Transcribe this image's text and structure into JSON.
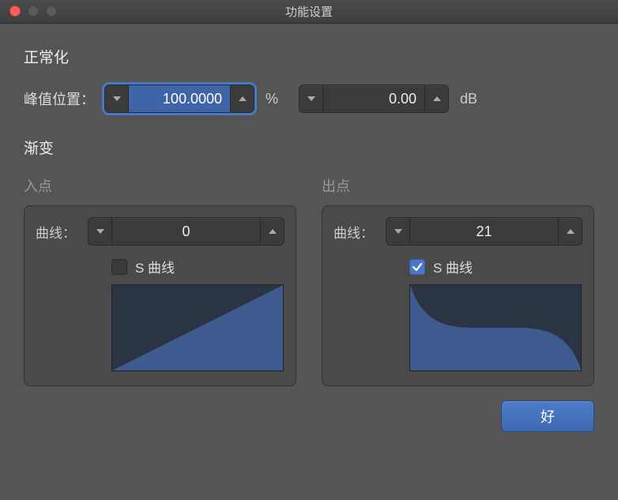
{
  "window": {
    "title": "功能设置"
  },
  "normalize": {
    "heading": "正常化",
    "peak_label": "峰值位置：",
    "percent_value": "100.0000",
    "percent_unit": "%",
    "db_value": "0.00",
    "db_unit": "dB"
  },
  "fade": {
    "heading": "渐变",
    "in": {
      "heading": "入点",
      "curve_label": "曲线：",
      "curve_value": "0",
      "s_curve_label": "S 曲线",
      "s_curve_checked": false
    },
    "out": {
      "heading": "出点",
      "curve_label": "曲线：",
      "curve_value": "21",
      "s_curve_label": "S 曲线",
      "s_curve_checked": true
    }
  },
  "footer": {
    "ok_label": "好"
  },
  "colors": {
    "accent": "#4a78c9",
    "curve_fill": "#3e5a8f",
    "curve_bg": "#2b3442"
  }
}
